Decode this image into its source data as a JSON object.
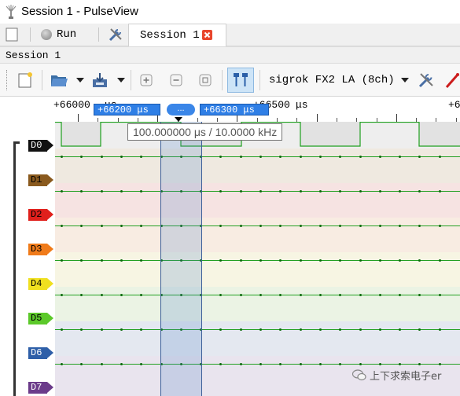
{
  "window": {
    "title": "Session 1 - PulseView"
  },
  "tabbar": {
    "run_label": "Run",
    "session_tab_label": "Session 1"
  },
  "session_bar": {
    "label": "Session 1"
  },
  "toolbar": {
    "device_label": "sigrok FX2 LA (8ch)"
  },
  "ruler": {
    "labels": [
      "+66000",
      "μs",
      "+66500",
      "μs",
      "+6"
    ],
    "cursor_left": "+66200 μs",
    "cursor_right": "+66300 μs",
    "cursor_middle": "...",
    "tooltip": "100.000000 μs / 10.0000 kHz"
  },
  "channels": [
    {
      "name": "D0",
      "color": "#111111"
    },
    {
      "name": "D1",
      "color": "#8a5a1e"
    },
    {
      "name": "D2",
      "color": "#e0201c"
    },
    {
      "name": "D3",
      "color": "#f07b1a"
    },
    {
      "name": "D4",
      "color": "#f0e020"
    },
    {
      "name": "D5",
      "color": "#5cc92a"
    },
    {
      "name": "D6",
      "color": "#2e5fa8"
    },
    {
      "name": "D7",
      "color": "#6b3b8a"
    }
  ],
  "watermark": "上下求索电子er"
}
